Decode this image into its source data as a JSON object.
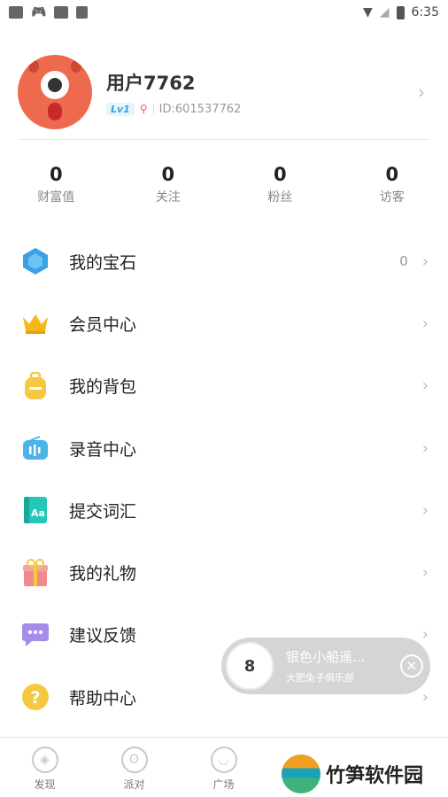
{
  "status_bar": {
    "time": "6:35",
    "left_icons": [
      "square-icon",
      "gamepad-icon",
      "image-icon",
      "font-icon"
    ],
    "right_icons": [
      "wifi-icon",
      "signal-icon",
      "battery-icon"
    ]
  },
  "profile": {
    "username": "用户7762",
    "level": "Lv1",
    "id_text": "ID:601537762"
  },
  "stats": [
    {
      "value": "0",
      "label": "财富值"
    },
    {
      "value": "0",
      "label": "关注"
    },
    {
      "value": "0",
      "label": "粉丝"
    },
    {
      "value": "0",
      "label": "访客"
    }
  ],
  "menu": [
    {
      "label": "我的宝石",
      "value": "0",
      "icon": "gem-icon",
      "color": "#3aa0e8"
    },
    {
      "label": "会员中心",
      "value": "",
      "icon": "crown-icon",
      "color": "#f5b818"
    },
    {
      "label": "我的背包",
      "value": "",
      "icon": "backpack-icon",
      "color": "#f5c842"
    },
    {
      "label": "录音中心",
      "value": "",
      "icon": "radio-icon",
      "color": "#4ab3e8"
    },
    {
      "label": "提交词汇",
      "value": "",
      "icon": "vocab-icon",
      "color": "#26c6b8"
    },
    {
      "label": "我的礼物",
      "value": "",
      "icon": "gift-icon",
      "color": "#f08a8a"
    },
    {
      "label": "建议反馈",
      "value": "",
      "icon": "feedback-icon",
      "color": "#a78bea"
    },
    {
      "label": "帮助中心",
      "value": "",
      "icon": "help-icon",
      "color": "#f5c842"
    }
  ],
  "player": {
    "title": "银色小船遥...",
    "subtitle": "大肥兔子俱乐部",
    "art_text": "8"
  },
  "bottom_nav": [
    {
      "label": "发现",
      "icon": "compass-icon"
    },
    {
      "label": "派对",
      "icon": "pig-icon"
    },
    {
      "label": "广场",
      "icon": "planet-icon"
    }
  ],
  "watermark": {
    "text": "竹笋软件园"
  }
}
